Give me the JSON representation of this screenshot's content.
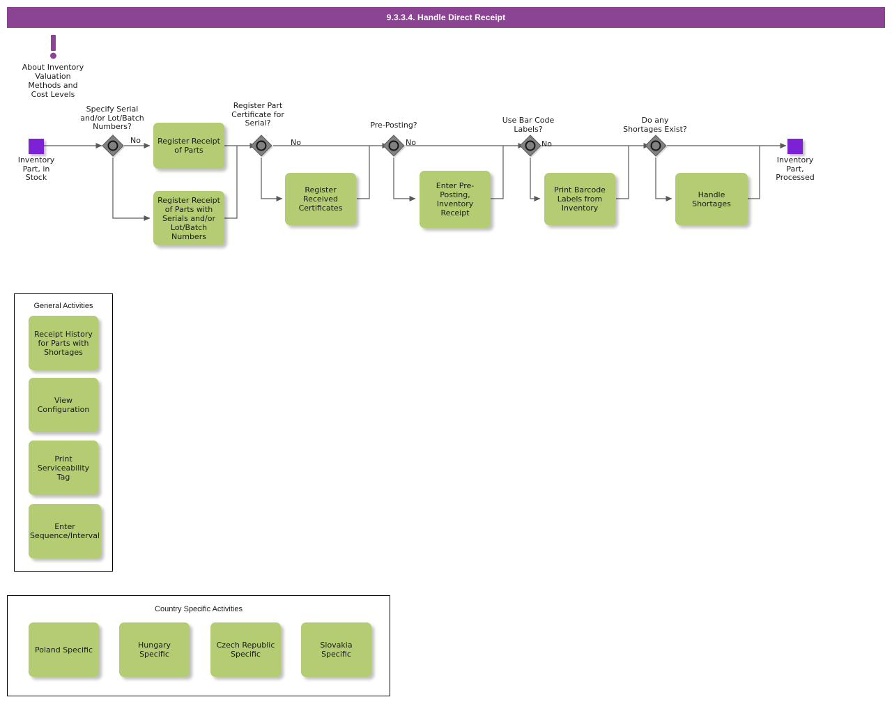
{
  "header": {
    "title": "9.3.3.4. Handle Direct Receipt",
    "bar_color": "#8b4393",
    "text_color": "#ffffff"
  },
  "theme": {
    "activity_fill": "#b5cd72",
    "terminator_fill": "#7d21d4",
    "decision_fill": "#808080",
    "note_color": "#8b4393",
    "connector_color": "#595959"
  },
  "note": {
    "icon": "exclamation-mark-icon",
    "label": "About Inventory\nValuation\nMethods and\nCost Levels"
  },
  "flow": {
    "start": {
      "name": "inventory-part-in-stock",
      "label": "Inventory\nPart, in\nStock"
    },
    "end": {
      "name": "inventory-part-processed",
      "label": "Inventory\nPart,\nProcessed"
    },
    "decisions": [
      {
        "id": "specify-serial",
        "label": "Specify Serial\nand/or Lot/Batch\nNumbers?",
        "no_label": "No"
      },
      {
        "id": "register-part-certificate",
        "label": "Register Part\nCertificate for\nSerial?",
        "no_label": "No"
      },
      {
        "id": "pre-posting",
        "label": "Pre-Posting?",
        "no_label": "No"
      },
      {
        "id": "use-bar-code-labels",
        "label": "Use Bar Code\nLabels?",
        "no_label": "No"
      },
      {
        "id": "shortages-exist",
        "label": "Do any\nShortages Exist?",
        "no_label": ""
      }
    ],
    "activities": [
      {
        "id": "register-receipt-of-parts",
        "label": "Register Receipt\nof Parts"
      },
      {
        "id": "register-receipt-of-parts-with-serials",
        "label": "Register Receipt\nof Parts with\nSerials and/or\nLot/Batch\nNumbers"
      },
      {
        "id": "register-received-certificates",
        "label": "Register\nReceived\nCertificates"
      },
      {
        "id": "enter-pre-posting-inventory-receipt",
        "label": "Enter Pre-\nPosting,\nInventory\nReceipt"
      },
      {
        "id": "print-barcode-labels-from-inventory",
        "label": "Print Barcode\nLabels from\nInventory"
      },
      {
        "id": "handle-shortages",
        "label": "Handle\nShortages"
      }
    ]
  },
  "general_activities": {
    "title": "General Activities",
    "items": [
      {
        "id": "receipt-history-for-parts-with-shortages",
        "label": "Receipt History\nfor Parts with\nShortages"
      },
      {
        "id": "view-configuration",
        "label": "View\nConfiguration"
      },
      {
        "id": "print-serviceability-tag",
        "label": "Print\nServiceability\nTag"
      },
      {
        "id": "enter-sequence-interval",
        "label": "Enter\nSequence/Interval"
      }
    ]
  },
  "country_specific_activities": {
    "title": "Country Specific Activities",
    "items": [
      {
        "id": "poland-specific",
        "label": "Poland Specific"
      },
      {
        "id": "hungary-specific",
        "label": "Hungary Specific"
      },
      {
        "id": "czech-republic-specific",
        "label": "Czech Republic\nSpecific"
      },
      {
        "id": "slovakia-specific",
        "label": "Slovakia\nSpecific"
      }
    ]
  }
}
